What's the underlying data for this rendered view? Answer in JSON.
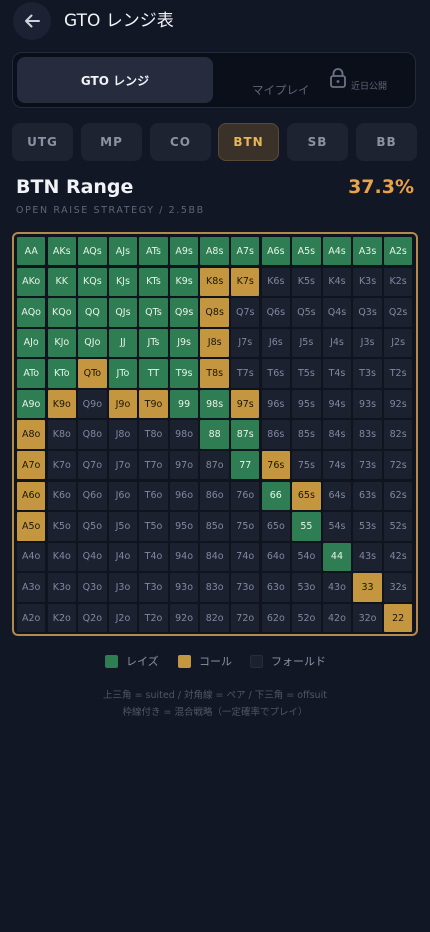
{
  "header": {
    "title": "GTO レンジ表",
    "back_icon": "arrow-left-icon"
  },
  "mode_toggle": {
    "active_label": "GTO レンジ",
    "inactive_label": "マイプレイ",
    "inactive_badge": "近日公開",
    "lock_icon": "lock-icon"
  },
  "positions": [
    {
      "label": "UTG",
      "active": false
    },
    {
      "label": "MP",
      "active": false
    },
    {
      "label": "CO",
      "active": false
    },
    {
      "label": "BTN",
      "active": true
    },
    {
      "label": "SB",
      "active": false
    },
    {
      "label": "BB",
      "active": false
    }
  ],
  "range": {
    "title": "BTN Range",
    "percent": "37.3%",
    "subtitle": "OPEN RAISE STRATEGY / 2.5BB"
  },
  "matrix": {
    "rows": [
      [
        [
          "AA",
          "r"
        ],
        [
          "AKs",
          "r"
        ],
        [
          "AQs",
          "r"
        ],
        [
          "AJs",
          "r"
        ],
        [
          "ATs",
          "r"
        ],
        [
          "A9s",
          "r"
        ],
        [
          "A8s",
          "r"
        ],
        [
          "A7s",
          "r"
        ],
        [
          "A6s",
          "r"
        ],
        [
          "A5s",
          "r"
        ],
        [
          "A4s",
          "r"
        ],
        [
          "A3s",
          "r"
        ],
        [
          "A2s",
          "r"
        ]
      ],
      [
        [
          "AKo",
          "r"
        ],
        [
          "KK",
          "r"
        ],
        [
          "KQs",
          "r"
        ],
        [
          "KJs",
          "r"
        ],
        [
          "KTs",
          "r"
        ],
        [
          "K9s",
          "r"
        ],
        [
          "K8s",
          "c"
        ],
        [
          "K7s",
          "c"
        ],
        [
          "K6s",
          "f"
        ],
        [
          "K5s",
          "f"
        ],
        [
          "K4s",
          "f"
        ],
        [
          "K3s",
          "f"
        ],
        [
          "K2s",
          "f"
        ]
      ],
      [
        [
          "AQo",
          "r"
        ],
        [
          "KQo",
          "r"
        ],
        [
          "QQ",
          "r"
        ],
        [
          "QJs",
          "r"
        ],
        [
          "QTs",
          "r"
        ],
        [
          "Q9s",
          "r"
        ],
        [
          "Q8s",
          "c"
        ],
        [
          "Q7s",
          "f"
        ],
        [
          "Q6s",
          "f"
        ],
        [
          "Q5s",
          "f"
        ],
        [
          "Q4s",
          "f"
        ],
        [
          "Q3s",
          "f"
        ],
        [
          "Q2s",
          "f"
        ]
      ],
      [
        [
          "AJo",
          "r"
        ],
        [
          "KJo",
          "r"
        ],
        [
          "QJo",
          "r"
        ],
        [
          "JJ",
          "r"
        ],
        [
          "JTs",
          "r"
        ],
        [
          "J9s",
          "r"
        ],
        [
          "J8s",
          "c"
        ],
        [
          "J7s",
          "f"
        ],
        [
          "J6s",
          "f"
        ],
        [
          "J5s",
          "f"
        ],
        [
          "J4s",
          "f"
        ],
        [
          "J3s",
          "f"
        ],
        [
          "J2s",
          "f"
        ]
      ],
      [
        [
          "ATo",
          "r"
        ],
        [
          "KTo",
          "r"
        ],
        [
          "QTo",
          "c"
        ],
        [
          "JTo",
          "r"
        ],
        [
          "TT",
          "r"
        ],
        [
          "T9s",
          "r"
        ],
        [
          "T8s",
          "c"
        ],
        [
          "T7s",
          "f"
        ],
        [
          "T6s",
          "f"
        ],
        [
          "T5s",
          "f"
        ],
        [
          "T4s",
          "f"
        ],
        [
          "T3s",
          "f"
        ],
        [
          "T2s",
          "f"
        ]
      ],
      [
        [
          "A9o",
          "r"
        ],
        [
          "K9o",
          "c"
        ],
        [
          "Q9o",
          "f"
        ],
        [
          "J9o",
          "c"
        ],
        [
          "T9o",
          "c"
        ],
        [
          "99",
          "r"
        ],
        [
          "98s",
          "r"
        ],
        [
          "97s",
          "c"
        ],
        [
          "96s",
          "f"
        ],
        [
          "95s",
          "f"
        ],
        [
          "94s",
          "f"
        ],
        [
          "93s",
          "f"
        ],
        [
          "92s",
          "f"
        ]
      ],
      [
        [
          "A8o",
          "c"
        ],
        [
          "K8o",
          "f"
        ],
        [
          "Q8o",
          "f"
        ],
        [
          "J8o",
          "f"
        ],
        [
          "T8o",
          "f"
        ],
        [
          "98o",
          "f"
        ],
        [
          "88",
          "r"
        ],
        [
          "87s",
          "r"
        ],
        [
          "86s",
          "f"
        ],
        [
          "85s",
          "f"
        ],
        [
          "84s",
          "f"
        ],
        [
          "83s",
          "f"
        ],
        [
          "82s",
          "f"
        ]
      ],
      [
        [
          "A7o",
          "c"
        ],
        [
          "K7o",
          "f"
        ],
        [
          "Q7o",
          "f"
        ],
        [
          "J7o",
          "f"
        ],
        [
          "T7o",
          "f"
        ],
        [
          "97o",
          "f"
        ],
        [
          "87o",
          "f"
        ],
        [
          "77",
          "r"
        ],
        [
          "76s",
          "c"
        ],
        [
          "75s",
          "f"
        ],
        [
          "74s",
          "f"
        ],
        [
          "73s",
          "f"
        ],
        [
          "72s",
          "f"
        ]
      ],
      [
        [
          "A6o",
          "c"
        ],
        [
          "K6o",
          "f"
        ],
        [
          "Q6o",
          "f"
        ],
        [
          "J6o",
          "f"
        ],
        [
          "T6o",
          "f"
        ],
        [
          "96o",
          "f"
        ],
        [
          "86o",
          "f"
        ],
        [
          "76o",
          "f"
        ],
        [
          "66",
          "r"
        ],
        [
          "65s",
          "c"
        ],
        [
          "64s",
          "f"
        ],
        [
          "63s",
          "f"
        ],
        [
          "62s",
          "f"
        ]
      ],
      [
        [
          "A5o",
          "c"
        ],
        [
          "K5o",
          "f"
        ],
        [
          "Q5o",
          "f"
        ],
        [
          "J5o",
          "f"
        ],
        [
          "T5o",
          "f"
        ],
        [
          "95o",
          "f"
        ],
        [
          "85o",
          "f"
        ],
        [
          "75o",
          "f"
        ],
        [
          "65o",
          "f"
        ],
        [
          "55",
          "r"
        ],
        [
          "54s",
          "f"
        ],
        [
          "53s",
          "f"
        ],
        [
          "52s",
          "f"
        ]
      ],
      [
        [
          "A4o",
          "f"
        ],
        [
          "K4o",
          "f"
        ],
        [
          "Q4o",
          "f"
        ],
        [
          "J4o",
          "f"
        ],
        [
          "T4o",
          "f"
        ],
        [
          "94o",
          "f"
        ],
        [
          "84o",
          "f"
        ],
        [
          "74o",
          "f"
        ],
        [
          "64o",
          "f"
        ],
        [
          "54o",
          "f"
        ],
        [
          "44",
          "r"
        ],
        [
          "43s",
          "f"
        ],
        [
          "42s",
          "f"
        ]
      ],
      [
        [
          "A3o",
          "f"
        ],
        [
          "K3o",
          "f"
        ],
        [
          "Q3o",
          "f"
        ],
        [
          "J3o",
          "f"
        ],
        [
          "T3o",
          "f"
        ],
        [
          "93o",
          "f"
        ],
        [
          "83o",
          "f"
        ],
        [
          "73o",
          "f"
        ],
        [
          "63o",
          "f"
        ],
        [
          "53o",
          "f"
        ],
        [
          "43o",
          "f"
        ],
        [
          "33",
          "c"
        ],
        [
          "32s",
          "f"
        ]
      ],
      [
        [
          "A2o",
          "f"
        ],
        [
          "K2o",
          "f"
        ],
        [
          "Q2o",
          "f"
        ],
        [
          "J2o",
          "f"
        ],
        [
          "T2o",
          "f"
        ],
        [
          "92o",
          "f"
        ],
        [
          "82o",
          "f"
        ],
        [
          "72o",
          "f"
        ],
        [
          "62o",
          "f"
        ],
        [
          "52o",
          "f"
        ],
        [
          "42o",
          "f"
        ],
        [
          "32o",
          "f"
        ],
        [
          "22",
          "c"
        ]
      ]
    ]
  },
  "legend": {
    "raise": "レイズ",
    "call": "コール",
    "fold": "フォールド"
  },
  "colors": {
    "raise": "#2f7d52",
    "call": "#c4963f",
    "fold": "#1c2130",
    "accent": "#e9a24a"
  },
  "notes": {
    "line1": "上三角 = suited / 対角線 = ペア / 下三角 = offsuit",
    "line2": "枠線付き = 混合戦略（一定確率でプレイ）"
  }
}
